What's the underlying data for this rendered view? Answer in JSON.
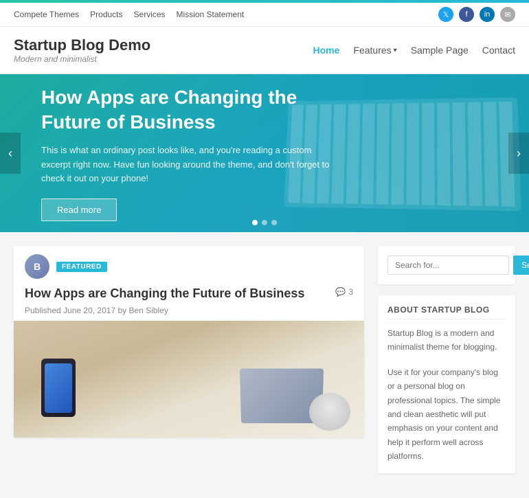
{
  "top_stripe": {},
  "topbar": {
    "links": [
      "Compete Themes",
      "Products",
      "Services",
      "Mission Statement"
    ],
    "social": [
      {
        "name": "twitter",
        "icon": "𝕏",
        "label": "twitter-icon"
      },
      {
        "name": "facebook",
        "icon": "f",
        "label": "facebook-icon"
      },
      {
        "name": "linkedin",
        "icon": "in",
        "label": "linkedin-icon"
      },
      {
        "name": "email",
        "icon": "✉",
        "label": "email-icon"
      }
    ]
  },
  "header": {
    "site_title": "Startup Blog Demo",
    "site_tagline": "Modern and minimalist",
    "nav": [
      {
        "label": "Home",
        "active": true
      },
      {
        "label": "Features",
        "has_dropdown": true
      },
      {
        "label": "Sample Page"
      },
      {
        "label": "Contact"
      }
    ]
  },
  "hero": {
    "title": "How Apps are Changing the Future of Business",
    "excerpt": "This is what an ordinary post looks like, and you're reading a custom excerpt right now. Have fun looking around the theme, and don't forget to check it out on your phone!",
    "read_more": "Read more",
    "dots": [
      true,
      false,
      false
    ]
  },
  "posts": [
    {
      "featured_label": "FEATURED",
      "title": "How Apps are Changing the Future of Business",
      "comment_count": "3",
      "meta": "Published June 20, 2017 by Ben Sibley"
    }
  ],
  "sidebar": {
    "search": {
      "placeholder": "Search for...",
      "button_label": "Search"
    },
    "about_widget": {
      "title": "ABOUT STARTUP BLOG",
      "text1": "Startup Blog is a modern and minimalist theme for blogging.",
      "text2": "Use it for your company's blog or a personal blog on professional topics. The simple and clean aesthetic will put emphasis on your content and help it perform well across platforms."
    }
  }
}
